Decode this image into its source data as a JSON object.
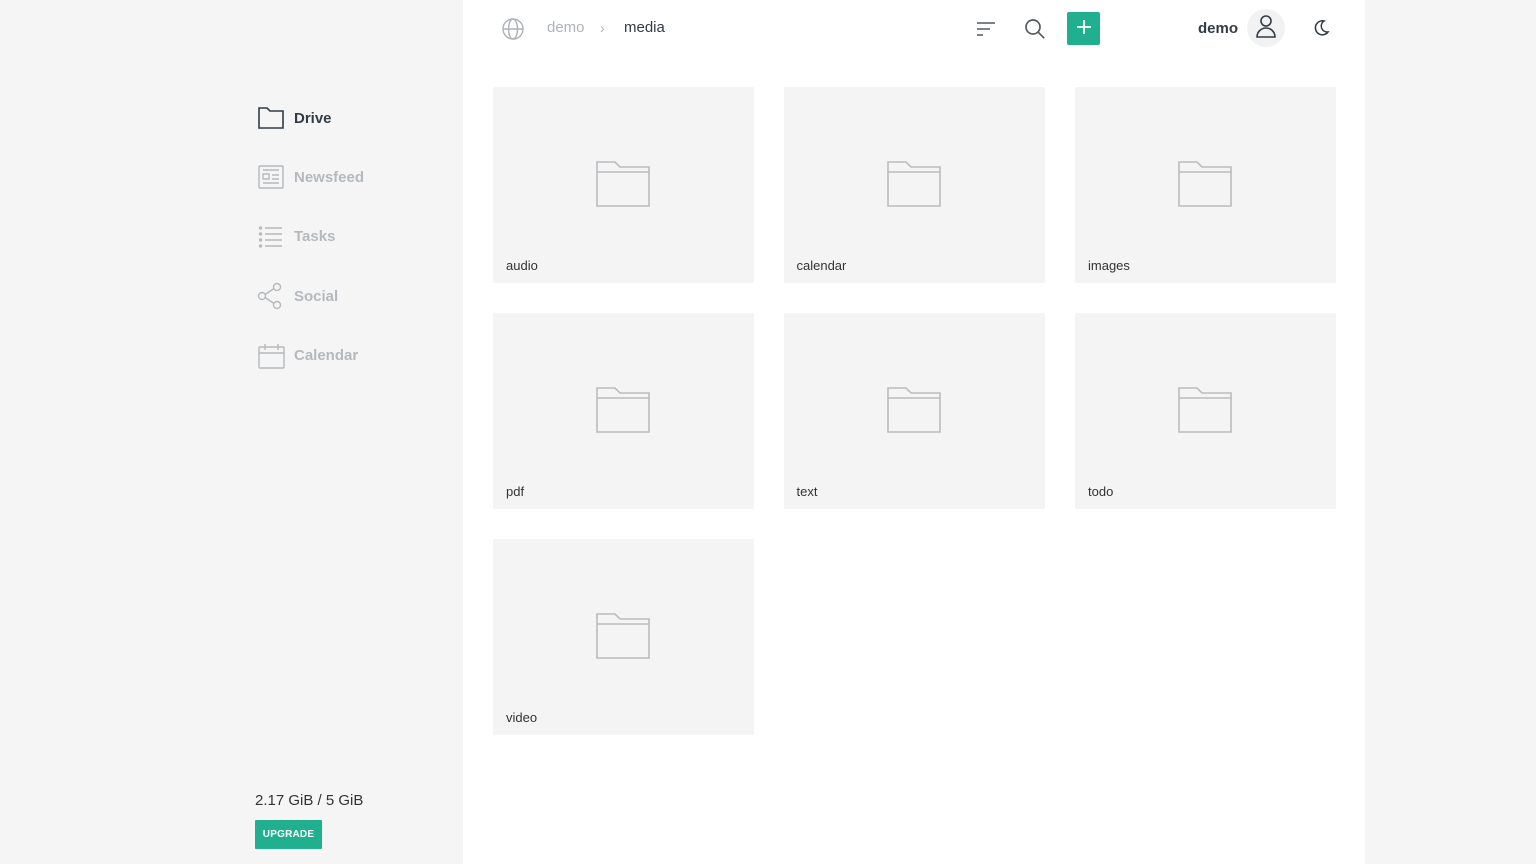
{
  "sidebar": {
    "items": [
      {
        "label": "Drive",
        "icon": "folder-icon",
        "active": true
      },
      {
        "label": "Newsfeed",
        "icon": "newspaper-icon",
        "active": false
      },
      {
        "label": "Tasks",
        "icon": "list-icon",
        "active": false
      },
      {
        "label": "Social",
        "icon": "share-icon",
        "active": false
      },
      {
        "label": "Calendar",
        "icon": "calendar-icon",
        "active": false
      }
    ],
    "storage": "2.17 GiB / 5 GiB",
    "upgrade_label": "UPGRADE"
  },
  "header": {
    "breadcrumb": {
      "root": "demo",
      "separator": "›",
      "current": "media"
    },
    "user": "demo"
  },
  "folders": [
    {
      "name": "audio"
    },
    {
      "name": "calendar"
    },
    {
      "name": "images"
    },
    {
      "name": "pdf"
    },
    {
      "name": "text"
    },
    {
      "name": "todo"
    },
    {
      "name": "video"
    }
  ],
  "colors": {
    "accent": "#20b08f",
    "sidebar_bg": "#f5f5f5",
    "main_bg": "#ffffff",
    "card_bg": "#f4f4f4"
  }
}
